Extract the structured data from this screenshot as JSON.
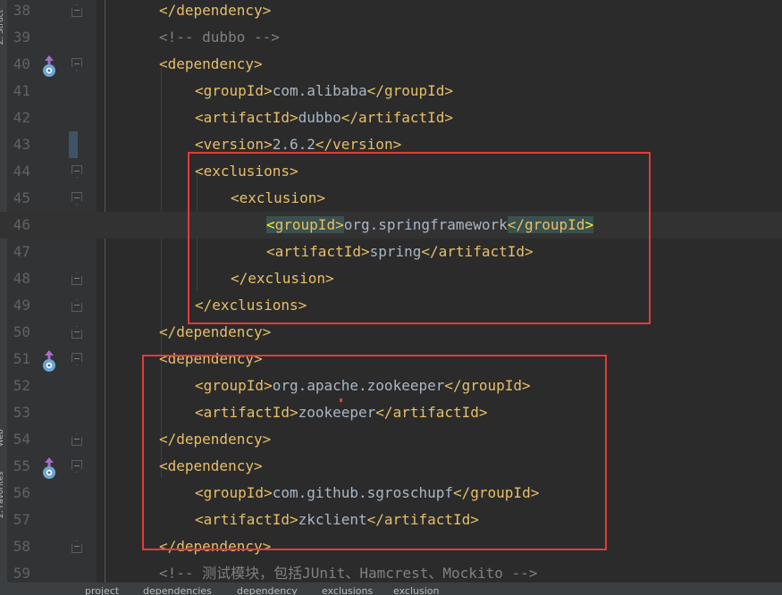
{
  "sidebar": {
    "labels": [
      "Z: Structure",
      "2: Favorites",
      "Web"
    ]
  },
  "editor": {
    "lines": [
      {
        "num": "38",
        "segments": [
          {
            "t": "tag",
            "v": "</dependency>"
          }
        ]
      },
      {
        "num": "39",
        "segments": [
          {
            "t": "comment",
            "v": "<!-- dubbo -->"
          }
        ]
      },
      {
        "num": "40",
        "segments": [
          {
            "t": "tag",
            "v": "<dependency>"
          }
        ]
      },
      {
        "num": "41",
        "segments": [
          {
            "t": "tag",
            "v": "<groupId>"
          },
          {
            "t": "text",
            "v": "com.alibaba"
          },
          {
            "t": "tag",
            "v": "</groupId>"
          }
        ]
      },
      {
        "num": "42",
        "segments": [
          {
            "t": "tag",
            "v": "<artifactId>"
          },
          {
            "t": "text",
            "v": "dubbo"
          },
          {
            "t": "tag",
            "v": "</artifactId>"
          }
        ]
      },
      {
        "num": "43",
        "segments": [
          {
            "t": "tag",
            "v": "<version>"
          },
          {
            "t": "text",
            "v": "2.6.2"
          },
          {
            "t": "tag",
            "v": "</version>"
          }
        ]
      },
      {
        "num": "44",
        "segments": [
          {
            "t": "tag",
            "v": "<exclusions>"
          }
        ]
      },
      {
        "num": "45",
        "segments": [
          {
            "t": "tag",
            "v": "<exclusion>"
          }
        ]
      },
      {
        "num": "46",
        "segments": [
          {
            "t": "bracket",
            "v": "<"
          },
          {
            "t": "match",
            "v": "groupId>"
          },
          {
            "t": "text",
            "v": "org.springframework"
          },
          {
            "t": "match",
            "v": "</groupId"
          },
          {
            "t": "bracket",
            "v": ">"
          }
        ]
      },
      {
        "num": "47",
        "segments": [
          {
            "t": "tag",
            "v": "<artifactId>"
          },
          {
            "t": "text",
            "v": "spring"
          },
          {
            "t": "tag",
            "v": "</artifactId>"
          }
        ]
      },
      {
        "num": "48",
        "segments": [
          {
            "t": "tag",
            "v": "</exclusion>"
          }
        ]
      },
      {
        "num": "49",
        "segments": [
          {
            "t": "tag",
            "v": "</exclusions>"
          }
        ]
      },
      {
        "num": "50",
        "segments": [
          {
            "t": "tag",
            "v": "</dependency>"
          }
        ]
      },
      {
        "num": "51",
        "segments": [
          {
            "t": "tag",
            "v": "<dependency>"
          }
        ]
      },
      {
        "num": "52",
        "segments": [
          {
            "t": "tag",
            "v": "<groupId>"
          },
          {
            "t": "text",
            "v": "org.apache.zookeeper"
          },
          {
            "t": "tag",
            "v": "</groupId>"
          }
        ]
      },
      {
        "num": "53",
        "segments": [
          {
            "t": "tag",
            "v": "<artifactId>"
          },
          {
            "t": "text",
            "v": "zookeeper"
          },
          {
            "t": "tag",
            "v": "</artifactId>"
          }
        ]
      },
      {
        "num": "54",
        "segments": [
          {
            "t": "tag",
            "v": "</dependency>"
          }
        ]
      },
      {
        "num": "55",
        "segments": [
          {
            "t": "tag",
            "v": "<dependency>"
          }
        ]
      },
      {
        "num": "56",
        "segments": [
          {
            "t": "tag",
            "v": "<groupId>"
          },
          {
            "t": "text",
            "v": "com.github.sgroschupf"
          },
          {
            "t": "tag",
            "v": "</groupId>"
          }
        ]
      },
      {
        "num": "57",
        "segments": [
          {
            "t": "tag",
            "v": "<artifactId>"
          },
          {
            "t": "text",
            "v": "zkclient"
          },
          {
            "t": "tag",
            "v": "</artifactId>"
          }
        ]
      },
      {
        "num": "58",
        "segments": [
          {
            "t": "tag",
            "v": "</dependency>"
          }
        ]
      },
      {
        "num": "59",
        "segments": [
          {
            "t": "comment",
            "v": "<!-- 测试模块，包括JUnit、Hamcrest、Mockito -->"
          }
        ]
      }
    ]
  },
  "breadcrumb": {
    "items": [
      "project",
      "dependencies",
      "dependency",
      "exclusions",
      "exclusion"
    ]
  },
  "colors": {
    "tag": "#e8bf6a",
    "text": "#a9b7c6",
    "comment": "#808080",
    "annotation_box": "#e43a3a"
  }
}
